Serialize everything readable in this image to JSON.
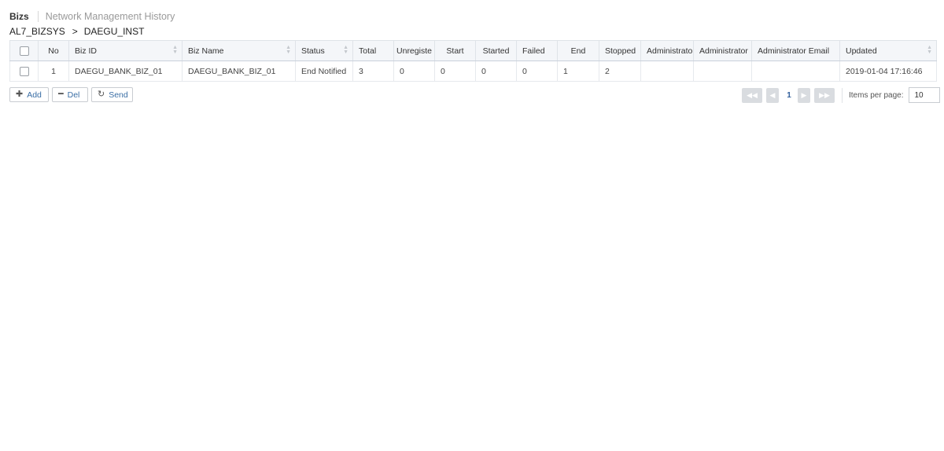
{
  "tabs": {
    "active": "Bizs",
    "inactive": "Network Management History"
  },
  "breadcrumb": {
    "root": "AL7_BIZSYS",
    "separator": ">",
    "current": "DAEGU_INST"
  },
  "table": {
    "headers": {
      "no": "No",
      "biz_id": "Biz ID",
      "biz_name": "Biz Name",
      "status": "Status",
      "total": "Total",
      "unregistered": "Unregiste",
      "start": "Start",
      "started": "Started",
      "failed": "Failed",
      "end": "End",
      "stopped": "Stopped",
      "admin1": "Administrato",
      "admin2": "Administrator",
      "admin_email": "Administrator Email",
      "updated": "Updated"
    },
    "rows": [
      {
        "no": "1",
        "biz_id": "DAEGU_BANK_BIZ_01",
        "biz_name": "DAEGU_BANK_BIZ_01",
        "status": "End Notified",
        "total": "3",
        "unregistered": "0",
        "start": "0",
        "started": "0",
        "failed": "0",
        "end": "1",
        "stopped": "2",
        "admin1": "",
        "admin2": "",
        "admin_email": "",
        "updated": "2019-01-04 17:16:46"
      }
    ]
  },
  "buttons": {
    "add": "Add",
    "del": "Del",
    "send": "Send"
  },
  "pager": {
    "current_page": "1",
    "items_per_page_label": "Items per page:",
    "items_per_page": "10"
  },
  "icons": {
    "sort": "sort-icon",
    "add": "plus-icon",
    "del": "minus-icon",
    "send": "send-icon"
  }
}
